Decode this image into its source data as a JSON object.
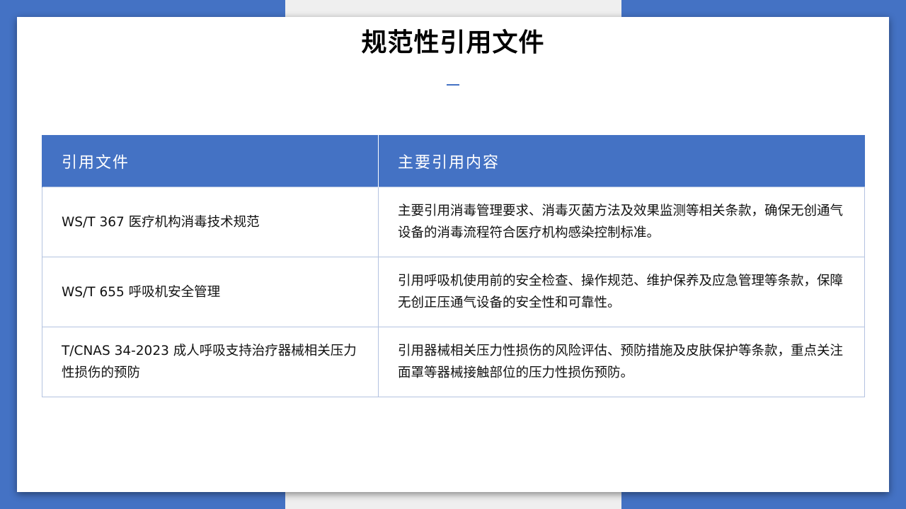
{
  "slide": {
    "title": "规范性引用文件"
  },
  "table": {
    "headers": [
      "引用文件",
      "主要引用内容"
    ],
    "rows": [
      {
        "document": "WS/T 367 医疗机构消毒技术规范",
        "content": "主要引用消毒管理要求、消毒灭菌方法及效果监测等相关条款，确保无创通气设备的消毒流程符合医疗机构感染控制标准。"
      },
      {
        "document": "WS/T 655 呼吸机安全管理",
        "content": "引用呼吸机使用前的安全检查、操作规范、维护保养及应急管理等条款，保障无创正压通气设备的安全性和可靠性。"
      },
      {
        "document": "T/CNAS 34-2023 成人呼吸支持治疗器械相关压力性损伤的预防",
        "content": "引用器械相关压力性损伤的风险评估、预防措施及皮肤保护等条款，重点关注面罩等器械接触部位的压力性损伤预防。"
      }
    ]
  },
  "colors": {
    "accent": "#4472c4",
    "background_strip": "#efefef",
    "card": "#ffffff"
  }
}
